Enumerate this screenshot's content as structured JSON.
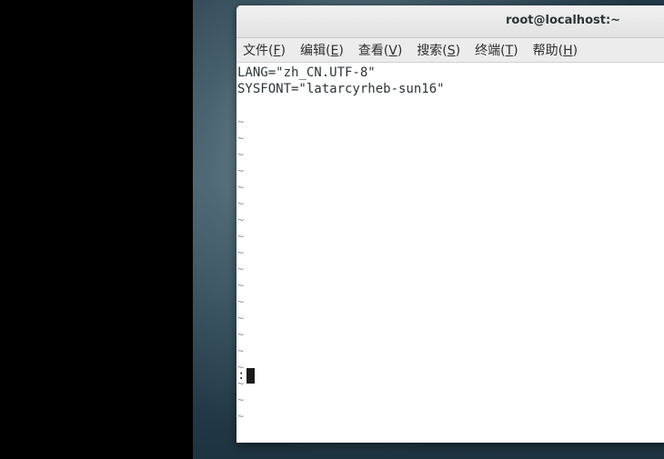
{
  "window": {
    "title": "root@localhost:~"
  },
  "menu": [
    {
      "label": "文件(",
      "mnemonic": "F",
      "close": ")"
    },
    {
      "label": "编辑(",
      "mnemonic": "E",
      "close": ")"
    },
    {
      "label": "查看(",
      "mnemonic": "V",
      "close": ")"
    },
    {
      "label": "搜索(",
      "mnemonic": "S",
      "close": ")"
    },
    {
      "label": "终端(",
      "mnemonic": "T",
      "close": ")"
    },
    {
      "label": "帮助(",
      "mnemonic": "H",
      "close": ")"
    }
  ],
  "editor": {
    "lines": [
      "LANG=\"zh_CN.UTF-8\"",
      "SYSFONT=\"latarcyrheb-sun16\"",
      ""
    ],
    "tilde_char": "~",
    "tilde_count": 19,
    "command_line": ":"
  }
}
